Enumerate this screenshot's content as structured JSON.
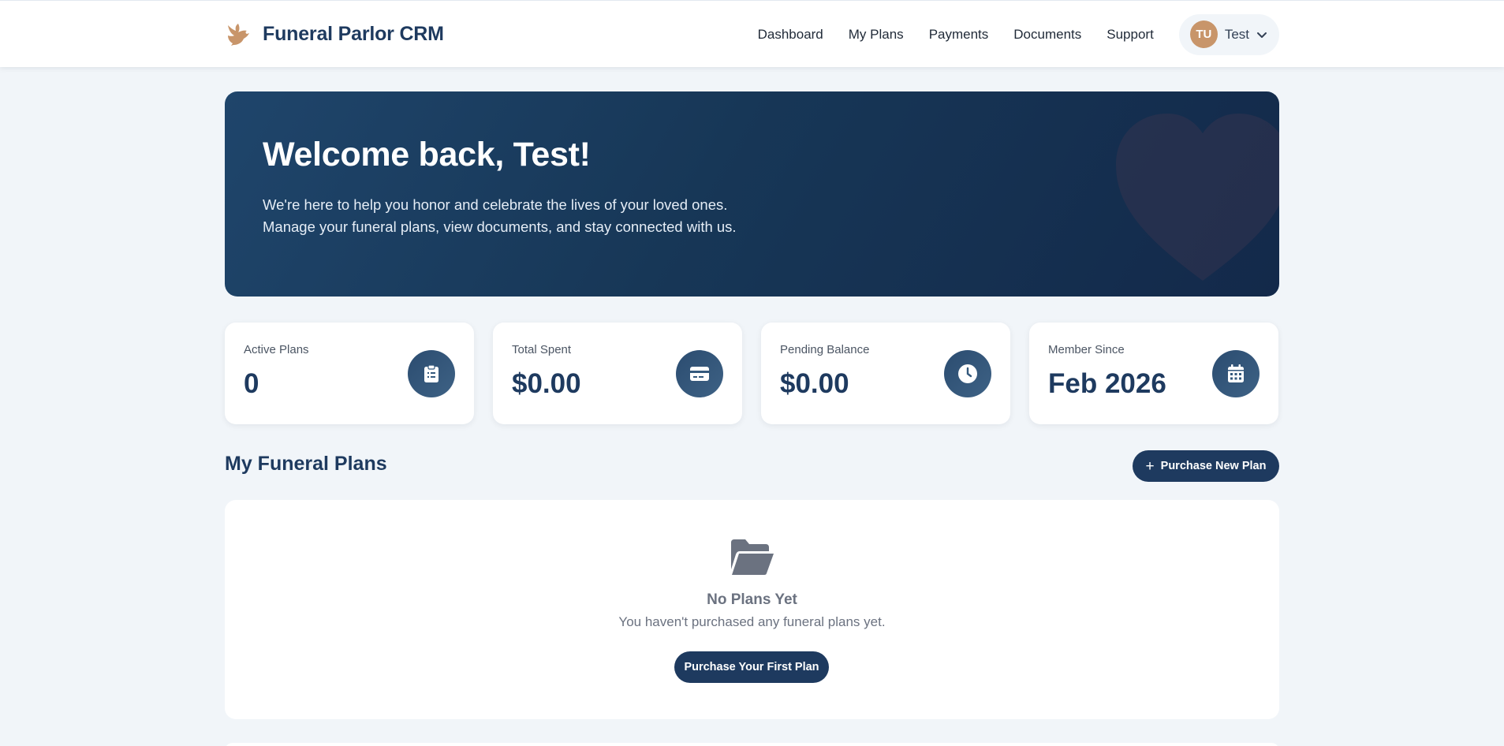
{
  "brand": {
    "name": "Funeral Parlor CRM",
    "logo_icon": "dove-icon",
    "accent": "#c8956a"
  },
  "nav": {
    "links": [
      "Dashboard",
      "My Plans",
      "Payments",
      "Documents",
      "Support"
    ],
    "user": {
      "initials": "TU",
      "name": "Test"
    }
  },
  "hero": {
    "title": "Welcome back, Test!",
    "text": "We're here to help you honor and celebrate the lives of your loved ones. Manage your funeral plans, view documents, and stay connected with us."
  },
  "stats": [
    {
      "label": "Active Plans",
      "value": "0",
      "icon": "clipboard-list-icon"
    },
    {
      "label": "Total Spent",
      "value": "$0.00",
      "icon": "credit-card-icon"
    },
    {
      "label": "Pending Balance",
      "value": "$0.00",
      "icon": "clock-icon"
    },
    {
      "label": "Member Since",
      "value": "Feb 2026",
      "icon": "calendar-icon"
    }
  ],
  "plans_section": {
    "title": "My Funeral Plans",
    "purchase_button": "Purchase New Plan",
    "empty": {
      "title": "No Plans Yet",
      "text": "You haven't purchased any funeral plans yet.",
      "button": "Purchase Your First Plan"
    }
  },
  "colors": {
    "primary": "#1e3a5f",
    "background": "#f1f5f9",
    "avatar": "#c8956a"
  }
}
